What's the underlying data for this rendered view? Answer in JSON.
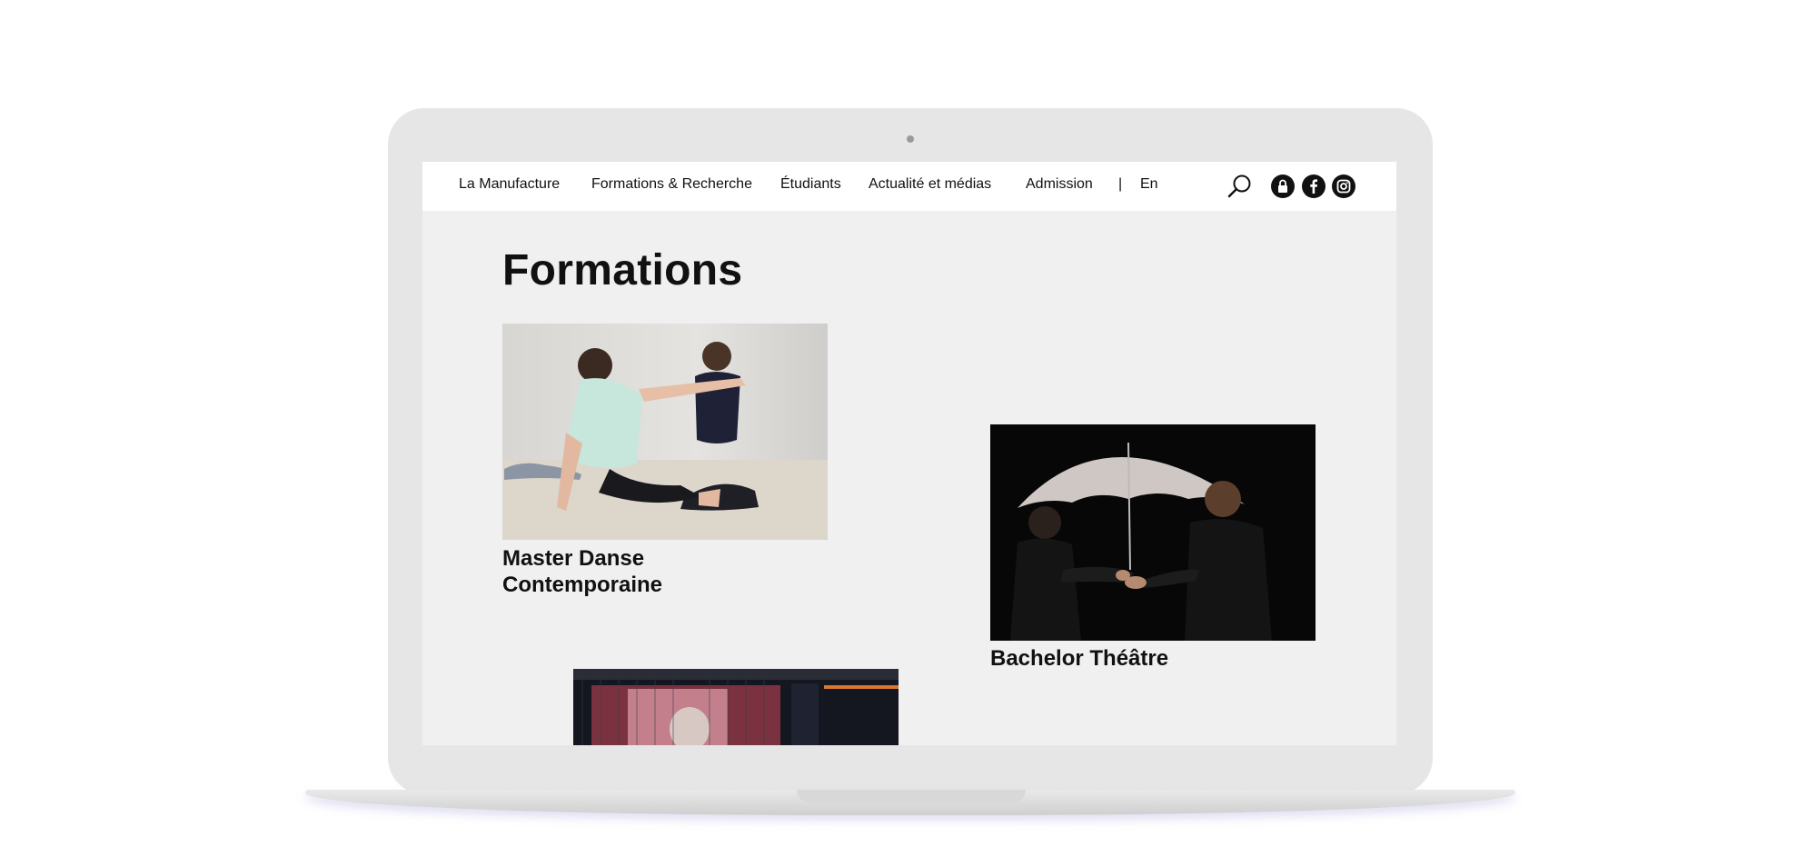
{
  "nav": {
    "items": [
      "La Manufacture",
      "Formations & Recherche",
      "Étudiants",
      "Actualité et médias",
      "Admission"
    ],
    "separator": "|",
    "language": "En"
  },
  "icons": [
    "search-icon",
    "lock-icon",
    "facebook-icon",
    "instagram-icon"
  ],
  "page": {
    "title": "Formations"
  },
  "formations": [
    {
      "title_line1": "Master Danse",
      "title_line2": "Contemporaine"
    },
    {
      "title": "Bachelor Théâtre"
    }
  ],
  "colors": {
    "page_background": "#f0f0f0",
    "navbar_background": "#ffffff",
    "text": "#111111",
    "laptop_frame": "#e6e6e6"
  }
}
